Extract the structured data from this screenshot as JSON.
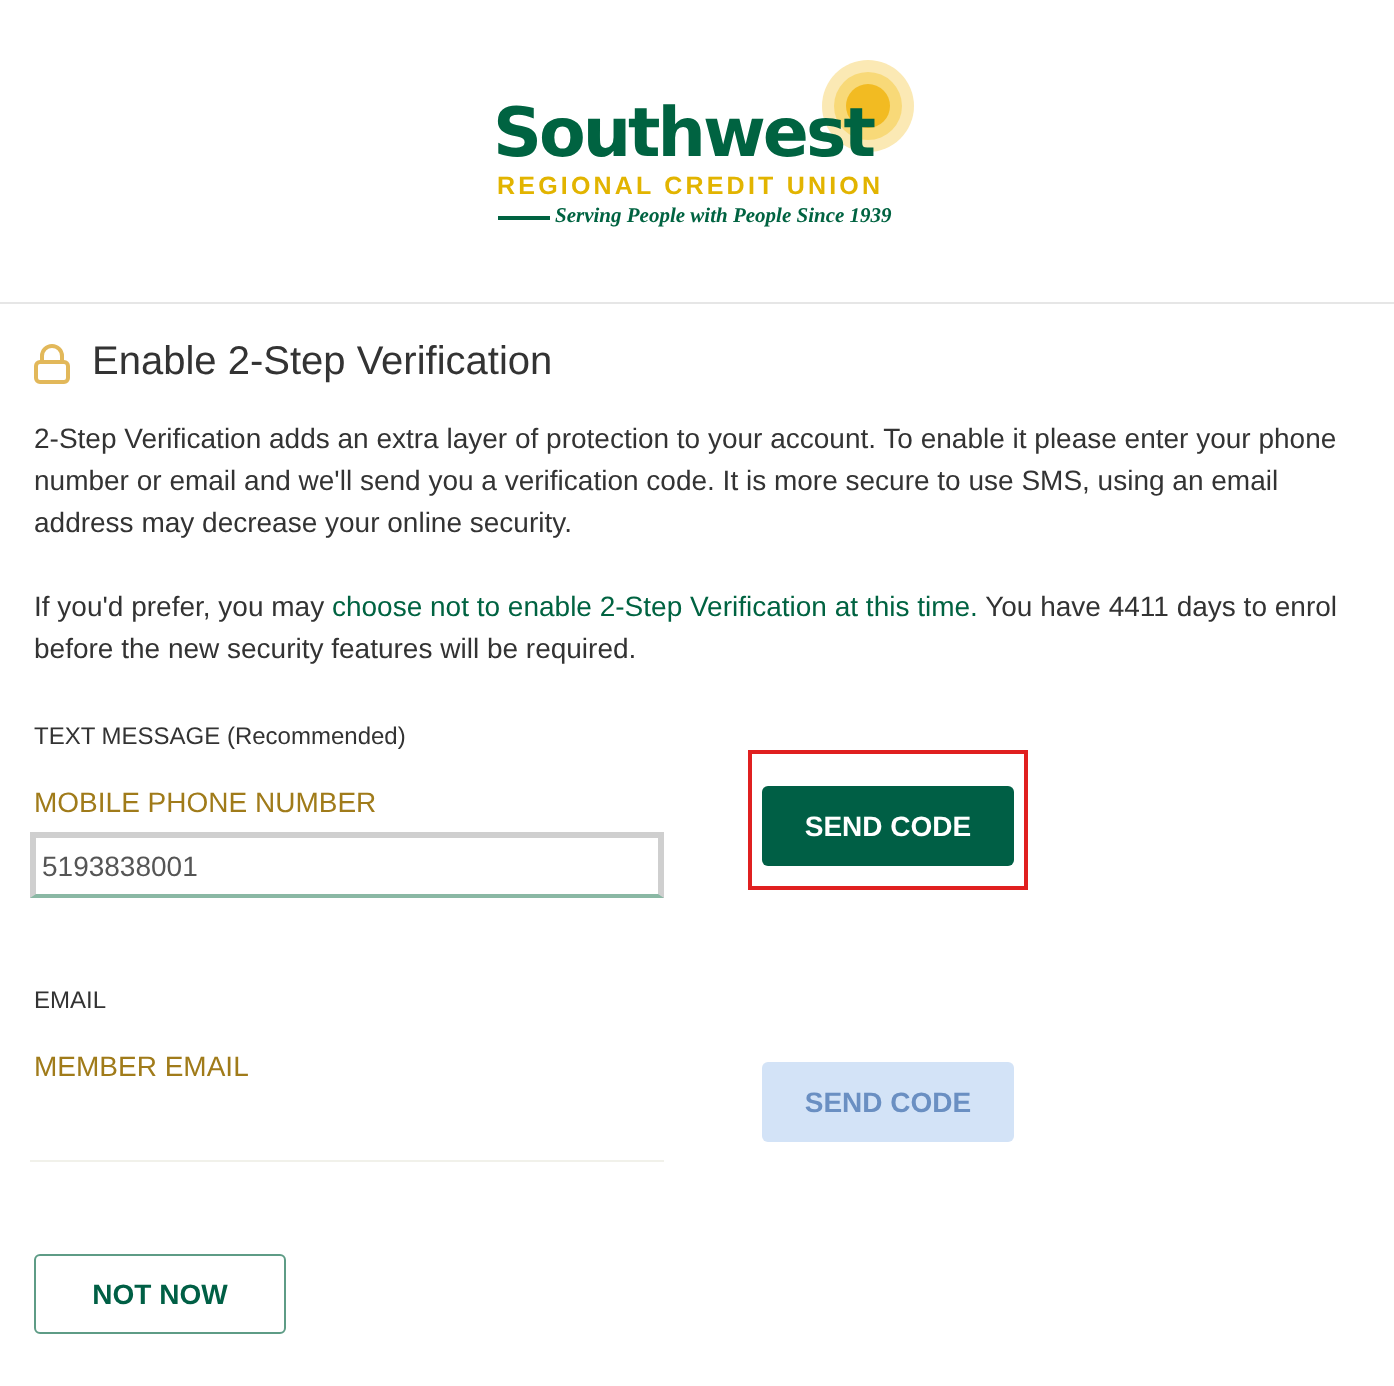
{
  "logo": {
    "name": "Southwest",
    "subtitle": "REGIONAL CREDIT UNION",
    "tagline": "Serving People with People Since 1939"
  },
  "heading": "Enable 2-Step Verification",
  "intro": "2-Step Verification adds an extra layer of protection to your account. To enable it please enter your phone number or email and we'll send you a verification code. It is more secure to use SMS, using an email address may decrease your online security.",
  "optout": {
    "before": "If you'd prefer, you may ",
    "link": "choose not to enable 2-Step Verification at this time.",
    "after": " You have 4411 days to enrol before the new security features will be required."
  },
  "methods": [
    {
      "title": "TEXT MESSAGE (Recommended)",
      "field_label": "MOBILE PHONE NUMBER",
      "value": "5193838001",
      "focused": true,
      "button": "SEND CODE",
      "disabled": false,
      "highlighted": true
    },
    {
      "title": "EMAIL",
      "field_label": "MEMBER EMAIL",
      "focused": false,
      "button": "SEND CODE",
      "disabled": true,
      "highlighted": false
    }
  ],
  "not_now": "NOT NOW"
}
